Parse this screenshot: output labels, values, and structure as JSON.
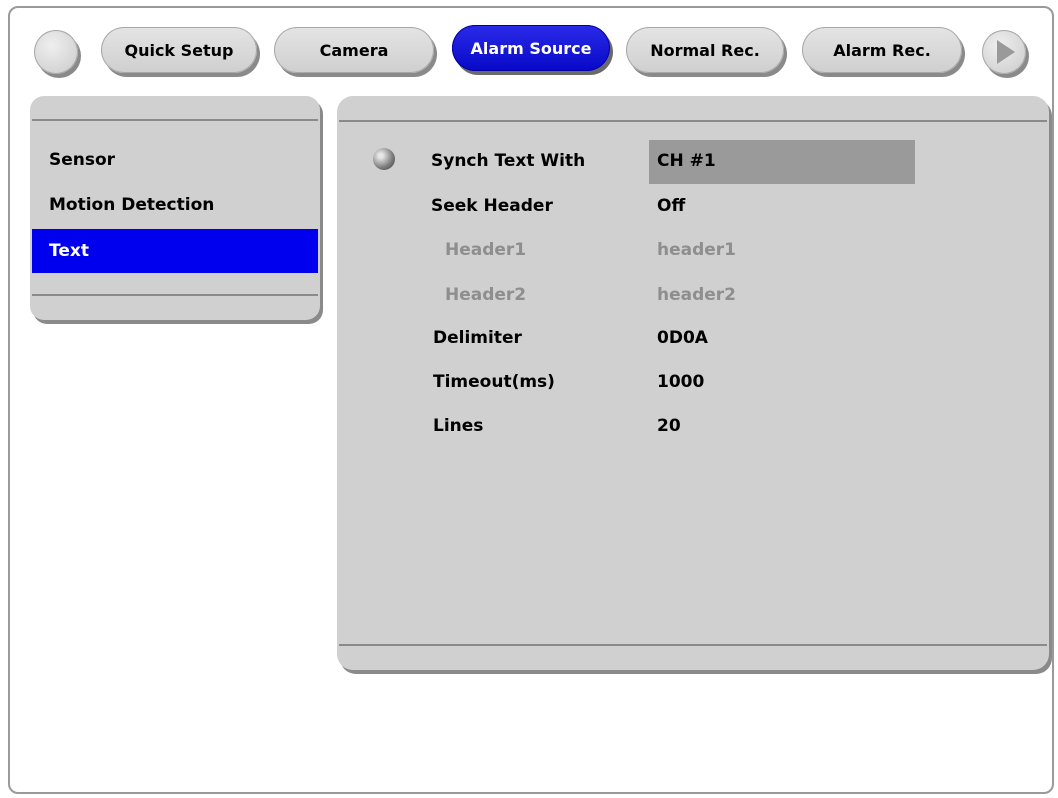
{
  "top_tabs": {
    "quick_setup": "Quick Setup",
    "camera": "Camera",
    "alarm_source": "Alarm Source",
    "normal_rec": "Normal Rec.",
    "alarm_rec": "Alarm Rec."
  },
  "sidebar": {
    "items": [
      {
        "label": "Sensor"
      },
      {
        "label": "Motion Detection"
      },
      {
        "label": "Text",
        "selected": true
      }
    ]
  },
  "settings": {
    "fields": [
      {
        "label": "Synch Text With",
        "value": "CH #1",
        "enabled": true
      },
      {
        "label": "Seek Header",
        "value": "Off",
        "enabled": true
      },
      {
        "label": "Header1",
        "value": "header1",
        "enabled": false
      },
      {
        "label": "Header2",
        "value": "header2",
        "enabled": false
      },
      {
        "label": "Delimiter",
        "value": "0D0A",
        "enabled": true
      },
      {
        "label": "Timeout(ms)",
        "value": "1000",
        "enabled": true
      },
      {
        "label": "Lines",
        "value": "20",
        "enabled": true
      }
    ]
  },
  "colors": {
    "active_tab": "#0808c8",
    "selected_item": "#0000ee",
    "panel": "#d0d0d0",
    "disabled_text": "#8e8e8e"
  },
  "icons": {
    "left_button": "blank-round-button",
    "right_button": "right-arrow-icon",
    "bullet": "radio-bullet-icon"
  }
}
